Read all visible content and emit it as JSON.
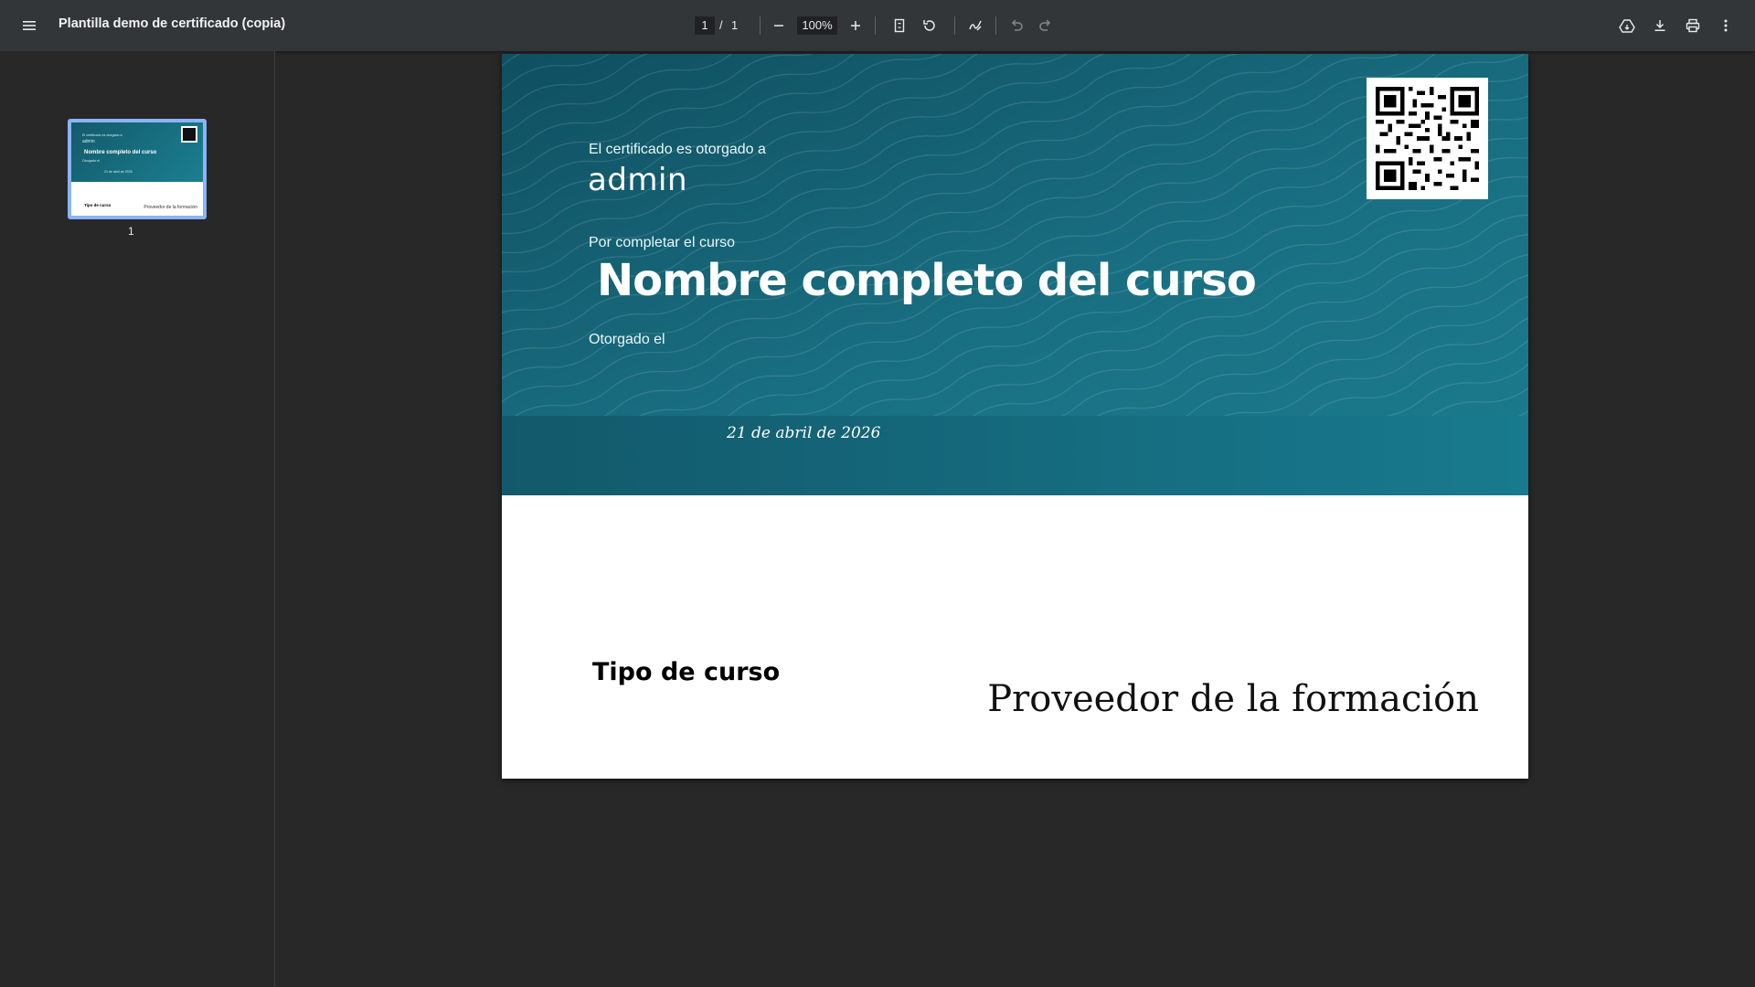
{
  "toolbar": {
    "title": "Plantilla demo de certificado (copia)",
    "page_current": "1",
    "page_separator": "/",
    "page_total": "1",
    "zoom": "100%",
    "icons": [
      "menu-icon",
      "zoom-out-icon",
      "zoom-in-icon",
      "fit-page-icon",
      "rotate-icon",
      "annotate-icon",
      "undo-icon",
      "redo-icon",
      "save-to-drive-icon",
      "download-icon",
      "print-icon",
      "more-icon"
    ]
  },
  "sidebar": {
    "thumbnail": {
      "page_number": "1",
      "mini_awarded": "El certificado es otorgado a",
      "mini_name": "admin",
      "mini_course": "Nombre completo del curso",
      "mini_granted": "Otorgado el",
      "mini_date": "21 de abril de 2026",
      "mini_type": "Tipo de curso",
      "mini_provider": "Proveedor de la formación"
    }
  },
  "certificate": {
    "awarded_label": "El certificado es otorgado a",
    "recipient": "admin",
    "course_label": "Por completar el curso",
    "course_name": "Nombre completo del curso",
    "granted_label": "Otorgado el",
    "date": "21 de abril de 2026",
    "course_type": "Tipo de curso",
    "provider": "Proveedor de la formación",
    "colors": {
      "banner_dark": "#0f4f60",
      "banner_light": "#1b7c8e"
    }
  }
}
